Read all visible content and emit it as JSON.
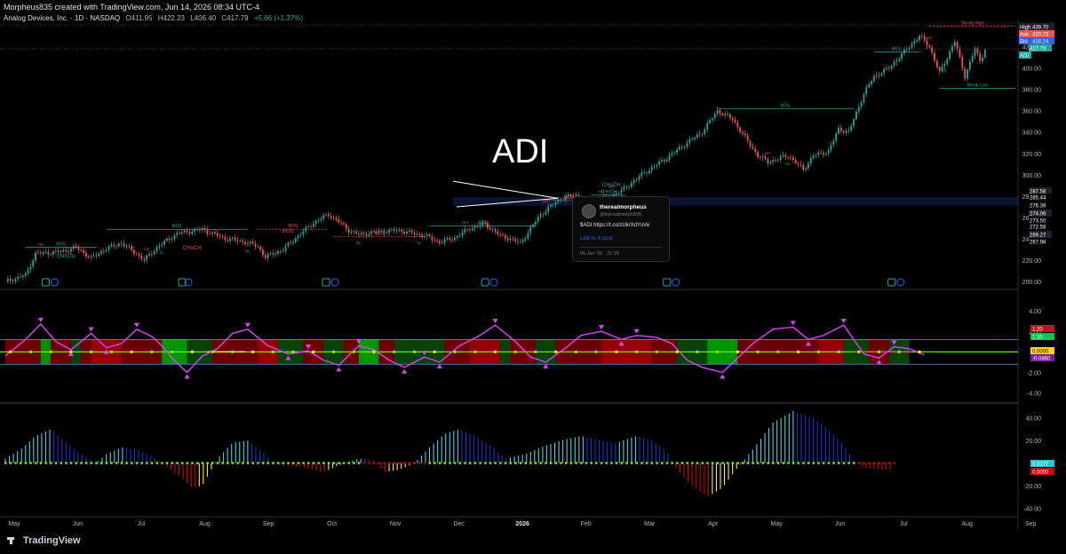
{
  "header": {
    "created_by": "Morpheus835 created with TradingView.com, Jun 14, 2026 08:34 UTC-4",
    "symbol_line": "Analog Devices, Inc. · 1D · NASDAQ",
    "open": "O411.95",
    "high": "H422.23",
    "low": "L406.40",
    "close": "C417.79",
    "change": "+5.66 (+1.37%)"
  },
  "overlay_text": "ADI",
  "tweet": {
    "name": "therealmorpheus",
    "handle": "@therealmorph835",
    "text": "$ADI https://t.co/zUkrXdYuVe",
    "link": "Link to X post",
    "date": "05 Jan '26 · 21:18"
  },
  "branding": "TradingView",
  "colors": {
    "up": "#26a69a",
    "down": "#ef5350",
    "bos_line": "#26a69a",
    "wave": "#e040fb",
    "zone_blue": "#1e3a8a"
  },
  "chart_data": [
    {
      "type": "candlestick",
      "ylim": [
        196,
        442
      ],
      "ticks": [
        200,
        220,
        240,
        260,
        280,
        300,
        320,
        340,
        360,
        380,
        400,
        420
      ],
      "x_labels": [
        "May",
        "Jun",
        "Jul",
        "Aug",
        "Sep",
        "Oct",
        "Nov",
        "Dec",
        "2026",
        "Feb",
        "Mar",
        "Apr",
        "May",
        "Jun",
        "Jul",
        "Aug",
        "Sep"
      ],
      "price_path": [
        [
          0,
          200
        ],
        [
          8,
          206
        ],
        [
          12,
          226
        ],
        [
          22,
          228
        ],
        [
          28,
          232
        ],
        [
          34,
          222
        ],
        [
          40,
          231
        ],
        [
          46,
          236
        ],
        [
          52,
          226
        ],
        [
          55,
          220
        ],
        [
          60,
          232
        ],
        [
          68,
          245
        ],
        [
          78,
          249
        ],
        [
          86,
          241
        ],
        [
          95,
          237
        ],
        [
          100,
          233
        ],
        [
          103,
          223
        ],
        [
          110,
          230
        ],
        [
          116,
          243
        ],
        [
          122,
          255
        ],
        [
          128,
          263
        ],
        [
          131,
          258
        ],
        [
          136,
          248
        ],
        [
          140,
          244
        ],
        [
          148,
          247
        ],
        [
          156,
          248
        ],
        [
          166,
          243
        ],
        [
          172,
          237
        ],
        [
          178,
          241
        ],
        [
          184,
          250
        ],
        [
          190,
          254
        ],
        [
          196,
          243
        ],
        [
          200,
          240
        ],
        [
          204,
          236
        ],
        [
          212,
          263
        ],
        [
          220,
          278
        ],
        [
          226,
          281
        ],
        [
          230,
          275
        ],
        [
          236,
          276
        ],
        [
          244,
          285
        ],
        [
          252,
          300
        ],
        [
          262,
          316
        ],
        [
          270,
          330
        ],
        [
          276,
          340
        ],
        [
          282,
          360
        ],
        [
          288,
          352
        ],
        [
          292,
          338
        ],
        [
          298,
          318
        ],
        [
          302,
          312
        ],
        [
          310,
          318
        ],
        [
          316,
          305
        ],
        [
          320,
          318
        ],
        [
          326,
          322
        ],
        [
          330,
          343
        ],
        [
          334,
          340
        ],
        [
          340,
          376
        ],
        [
          344,
          392
        ],
        [
          350,
          400
        ],
        [
          356,
          415
        ],
        [
          362,
          430
        ],
        [
          366,
          420
        ],
        [
          370,
          395
        ],
        [
          376,
          425
        ],
        [
          380,
          392
        ],
        [
          384,
          418
        ],
        [
          386,
          406
        ],
        [
          388,
          418
        ]
      ],
      "axis_tags": [
        {
          "label": "High",
          "value": "439.70",
          "color": "#1e222d"
        },
        {
          "label": "Ask",
          "value": "420.73",
          "color": "#ef5350"
        },
        {
          "label": "Bid",
          "value": "418.24",
          "color": "#2962ff"
        },
        {
          "label": "",
          "value": "417.79",
          "color": "#26a69a"
        },
        {
          "label": "ADI",
          "value": "",
          "color": "#26a69a"
        },
        {
          "label": "",
          "value": "287.58",
          "color": "#1e222d"
        },
        {
          "label": "",
          "value": "285.44",
          "color": "#000000"
        },
        {
          "label": "",
          "value": "276.39",
          "color": "#000000"
        },
        {
          "label": "",
          "value": "274.06",
          "color": "#1e222d"
        },
        {
          "label": "",
          "value": "273.50",
          "color": "#000000"
        },
        {
          "label": "",
          "value": "272.58",
          "color": "#000000"
        },
        {
          "label": "",
          "value": "269.27",
          "color": "#1e222d"
        },
        {
          "label": "",
          "value": "267.98",
          "color": "#000000"
        }
      ],
      "bos_levels": [
        {
          "from": 8,
          "to": 36,
          "value": 232,
          "label": "BOS",
          "color": "#26a69a"
        },
        {
          "from": 40,
          "to": 96,
          "value": 249,
          "label": "BOS",
          "color": "#26a69a"
        },
        {
          "from": 100,
          "to": 128,
          "value": 249,
          "label": "BOS",
          "color": "#ef5350"
        },
        {
          "from": 130,
          "to": 166,
          "value": 242,
          "label": "BOS",
          "color": "#ef5350"
        },
        {
          "from": 168,
          "to": 210,
          "value": 252,
          "label": "BOS",
          "color": "#26a69a"
        },
        {
          "from": 214,
          "to": 232,
          "value": 276,
          "label": "BOS",
          "color": "#ef5350"
        },
        {
          "from": 232,
          "to": 246,
          "value": 281,
          "label": "CHoCH",
          "color": "#26a69a"
        },
        {
          "from": 282,
          "to": 336,
          "value": 362,
          "label": "BOS",
          "color": "#26a69a"
        },
        {
          "from": 344,
          "to": 362,
          "value": 415,
          "label": "BOS",
          "color": "#26a69a"
        },
        {
          "from": 366,
          "to": 400,
          "value": 439,
          "label": "Strong High",
          "color": "#ef5350"
        },
        {
          "from": 370,
          "to": 400,
          "value": 381,
          "label": "Weak Low",
          "color": "#26a69a"
        }
      ],
      "swing_labels": [
        "HH",
        "LH",
        "HL",
        "LL",
        "HH",
        "HH",
        "LL",
        "HL",
        "HH",
        "HL",
        "HH",
        "HL",
        "HH",
        "LH",
        "HL"
      ],
      "change_labels": [
        "CHoCH",
        "CHoCH",
        "CHoCH",
        "BOS",
        "BOS"
      ]
    },
    {
      "type": "line",
      "name": "oscillator",
      "ylim": [
        -4.8,
        5.2
      ],
      "ticks": [
        4.0,
        2.0,
        0,
        -2.0,
        -4.0
      ],
      "band_levels": [
        1.2,
        0,
        -1.2
      ],
      "axis_tags": [
        "1.20",
        "1.20",
        "0.0000",
        "-0.0860"
      ],
      "wave_path": [
        [
          0,
          -0.4
        ],
        [
          8,
          1.2
        ],
        [
          14,
          2.7
        ],
        [
          20,
          1.0
        ],
        [
          26,
          0.2
        ],
        [
          34,
          1.8
        ],
        [
          40,
          0.4
        ],
        [
          46,
          0.8
        ],
        [
          52,
          2.2
        ],
        [
          58,
          1.5
        ],
        [
          62,
          0.6
        ],
        [
          66,
          -0.6
        ],
        [
          72,
          -2.0
        ],
        [
          78,
          -0.4
        ],
        [
          84,
          0.3
        ],
        [
          90,
          1.8
        ],
        [
          96,
          2.2
        ],
        [
          104,
          0.6
        ],
        [
          112,
          -0.2
        ],
        [
          120,
          0.1
        ],
        [
          126,
          -0.8
        ],
        [
          132,
          -1.3
        ],
        [
          140,
          0.6
        ],
        [
          146,
          0.2
        ],
        [
          152,
          -0.8
        ],
        [
          158,
          -1.5
        ],
        [
          166,
          -0.5
        ],
        [
          172,
          -1.0
        ],
        [
          180,
          0.6
        ],
        [
          188,
          1.6
        ],
        [
          194,
          2.6
        ],
        [
          202,
          1.0
        ],
        [
          208,
          -0.5
        ],
        [
          214,
          -1.0
        ],
        [
          222,
          0.4
        ],
        [
          228,
          1.6
        ],
        [
          236,
          2.0
        ],
        [
          244,
          1.2
        ],
        [
          250,
          1.6
        ],
        [
          258,
          1.4
        ],
        [
          264,
          0.8
        ],
        [
          270,
          -0.8
        ],
        [
          276,
          -1.5
        ],
        [
          284,
          -2.0
        ],
        [
          290,
          -0.6
        ],
        [
          296,
          0.8
        ],
        [
          304,
          2.2
        ],
        [
          312,
          2.4
        ],
        [
          318,
          1.2
        ],
        [
          324,
          1.6
        ],
        [
          332,
          2.6
        ],
        [
          340,
          -0.2
        ],
        [
          346,
          -0.6
        ],
        [
          352,
          0.5
        ],
        [
          358,
          0.3
        ],
        [
          364,
          -0.3
        ]
      ]
    },
    {
      "type": "bar",
      "name": "momentum histogram",
      "ylim": [
        -46,
        50
      ],
      "ticks": [
        40.0,
        20.0,
        0,
        -20.0,
        -40.0
      ],
      "axis_tags": [
        "0.3177",
        "0.0000"
      ],
      "hist_path": [
        [
          0,
          4
        ],
        [
          6,
          12
        ],
        [
          12,
          24
        ],
        [
          18,
          30
        ],
        [
          24,
          18
        ],
        [
          30,
          8
        ],
        [
          36,
          0
        ],
        [
          40,
          8
        ],
        [
          46,
          14
        ],
        [
          52,
          12
        ],
        [
          58,
          6
        ],
        [
          62,
          0
        ],
        [
          68,
          -10
        ],
        [
          74,
          -22
        ],
        [
          78,
          -20
        ],
        [
          84,
          4
        ],
        [
          90,
          18
        ],
        [
          96,
          20
        ],
        [
          102,
          10
        ],
        [
          106,
          0
        ],
        [
          110,
          -2
        ],
        [
          118,
          -4
        ],
        [
          126,
          -8
        ],
        [
          132,
          -2
        ],
        [
          140,
          4
        ],
        [
          146,
          2
        ],
        [
          150,
          -8
        ],
        [
          156,
          -6
        ],
        [
          162,
          0
        ],
        [
          168,
          14
        ],
        [
          174,
          26
        ],
        [
          180,
          30
        ],
        [
          186,
          24
        ],
        [
          192,
          16
        ],
        [
          198,
          4
        ],
        [
          206,
          8
        ],
        [
          212,
          14
        ],
        [
          220,
          20
        ],
        [
          228,
          24
        ],
        [
          236,
          20
        ],
        [
          242,
          18
        ],
        [
          250,
          24
        ],
        [
          256,
          20
        ],
        [
          262,
          10
        ],
        [
          266,
          -6
        ],
        [
          272,
          -20
        ],
        [
          278,
          -30
        ],
        [
          284,
          -22
        ],
        [
          290,
          -4
        ],
        [
          296,
          12
        ],
        [
          304,
          36
        ],
        [
          312,
          46
        ],
        [
          320,
          40
        ],
        [
          326,
          30
        ],
        [
          332,
          16
        ],
        [
          336,
          2
        ],
        [
          340,
          -4
        ],
        [
          346,
          -6
        ],
        [
          352,
          -6
        ]
      ]
    }
  ]
}
